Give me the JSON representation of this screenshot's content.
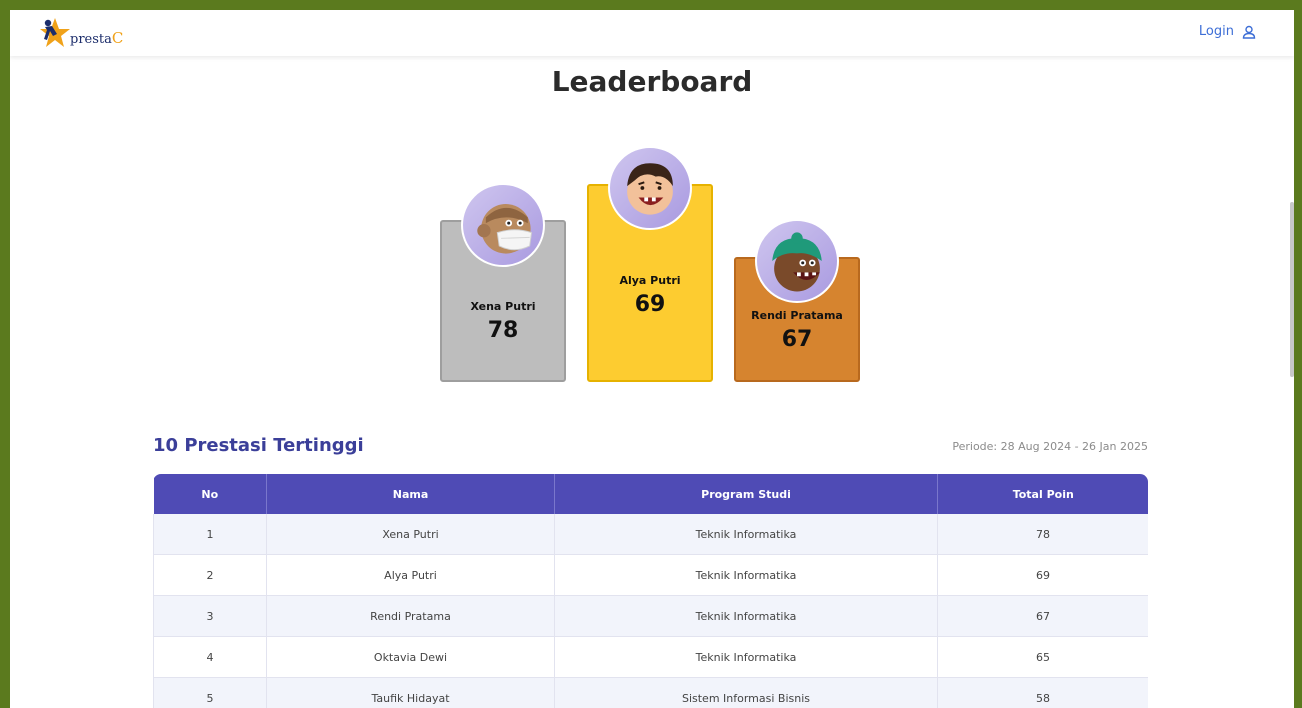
{
  "brand": {
    "name": "presta",
    "suffix": "C"
  },
  "nav": {
    "login_label": "Login"
  },
  "page": {
    "title": "Leaderboard"
  },
  "podium": {
    "first": {
      "name": "Alya Putri",
      "score": "69"
    },
    "second": {
      "name": "Xena Putri",
      "score": "78"
    },
    "third": {
      "name": "Rendi Pratama",
      "score": "67"
    }
  },
  "section": {
    "title": "10 Prestasi Tertinggi",
    "periode": "Periode: 28 Aug 2024 - 26 Jan 2025"
  },
  "table": {
    "headers": [
      "No",
      "Nama",
      "Program Studi",
      "Total Poin"
    ],
    "rows": [
      [
        "1",
        "Xena Putri",
        "Teknik Informatika",
        "78"
      ],
      [
        "2",
        "Alya Putri",
        "Teknik Informatika",
        "69"
      ],
      [
        "3",
        "Rendi Pratama",
        "Teknik Informatika",
        "67"
      ],
      [
        "4",
        "Oktavia Dewi",
        "Teknik Informatika",
        "65"
      ],
      [
        "5",
        "Taufik Hidayat",
        "Sistem Informasi Bisnis",
        "58"
      ]
    ]
  },
  "colors": {
    "frame": "#5b7a1e",
    "accent": "#4f4bb5",
    "gold": "#fdcc30",
    "silver": "#bdbdbd",
    "bronze": "#d6842f"
  },
  "icons": {
    "login": "user-icon",
    "logo": "star-person-logo-icon"
  }
}
